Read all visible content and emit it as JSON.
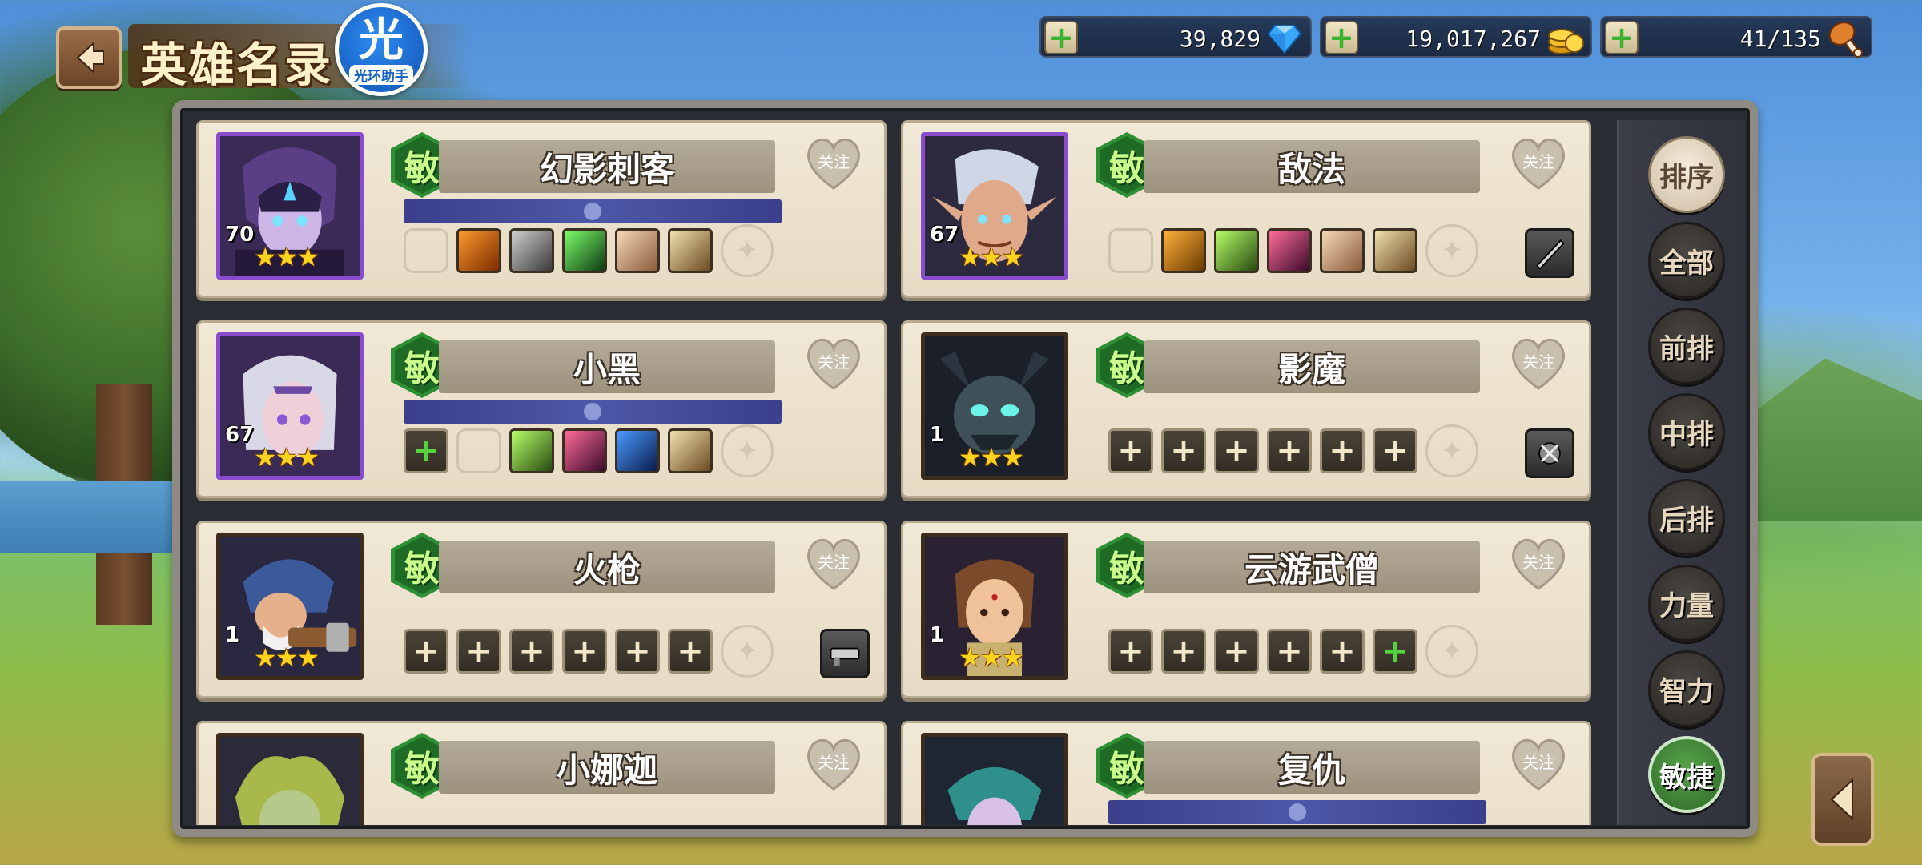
{
  "header": {
    "title": "英雄名录",
    "helper_char": "光",
    "helper_label": "光环助手"
  },
  "resources": [
    {
      "value": "39,829",
      "icon": "diamond-icon"
    },
    {
      "value": "19,017,267",
      "icon": "gold-coin-icon"
    },
    {
      "value": "41/135",
      "icon": "meat-drumstick-icon"
    }
  ],
  "resource_plus": "+",
  "follow_label": "关注",
  "heroes": [
    {
      "name": "幻影刺客",
      "type": "敏",
      "level": "70",
      "stars": "★★★",
      "frame": "purple"
    },
    {
      "name": "敌法",
      "type": "敏",
      "level": "67",
      "stars": "★★★",
      "frame": "purple"
    },
    {
      "name": "小黑",
      "type": "敏",
      "level": "67",
      "stars": "★★★",
      "frame": "purple"
    },
    {
      "name": "影魔",
      "type": "敏",
      "level": "1",
      "stars": "★★★",
      "frame": "dark"
    },
    {
      "name": "火枪",
      "type": "敏",
      "level": "1",
      "stars": "★★★",
      "frame": "dark"
    },
    {
      "name": "云游武僧",
      "type": "敏",
      "level": "1",
      "stars": "★★★",
      "frame": "dark"
    },
    {
      "name": "小娜迦",
      "type": "敏",
      "level": "",
      "stars": "",
      "frame": "dark"
    },
    {
      "name": "复仇",
      "type": "敏",
      "level": "",
      "stars": "",
      "frame": "dark"
    }
  ],
  "side_tabs": {
    "sort": "排序",
    "all": "全部",
    "front": "前排",
    "middle": "中排",
    "back": "后排",
    "strength": "力量",
    "intelligence": "智力",
    "agility": "敏捷"
  },
  "colors": {
    "agility_green": "#2f8f36",
    "panel_bg": "#2a2c33",
    "card_bg": "#f1e8d6",
    "purple_frame": "#8a4bcf"
  }
}
